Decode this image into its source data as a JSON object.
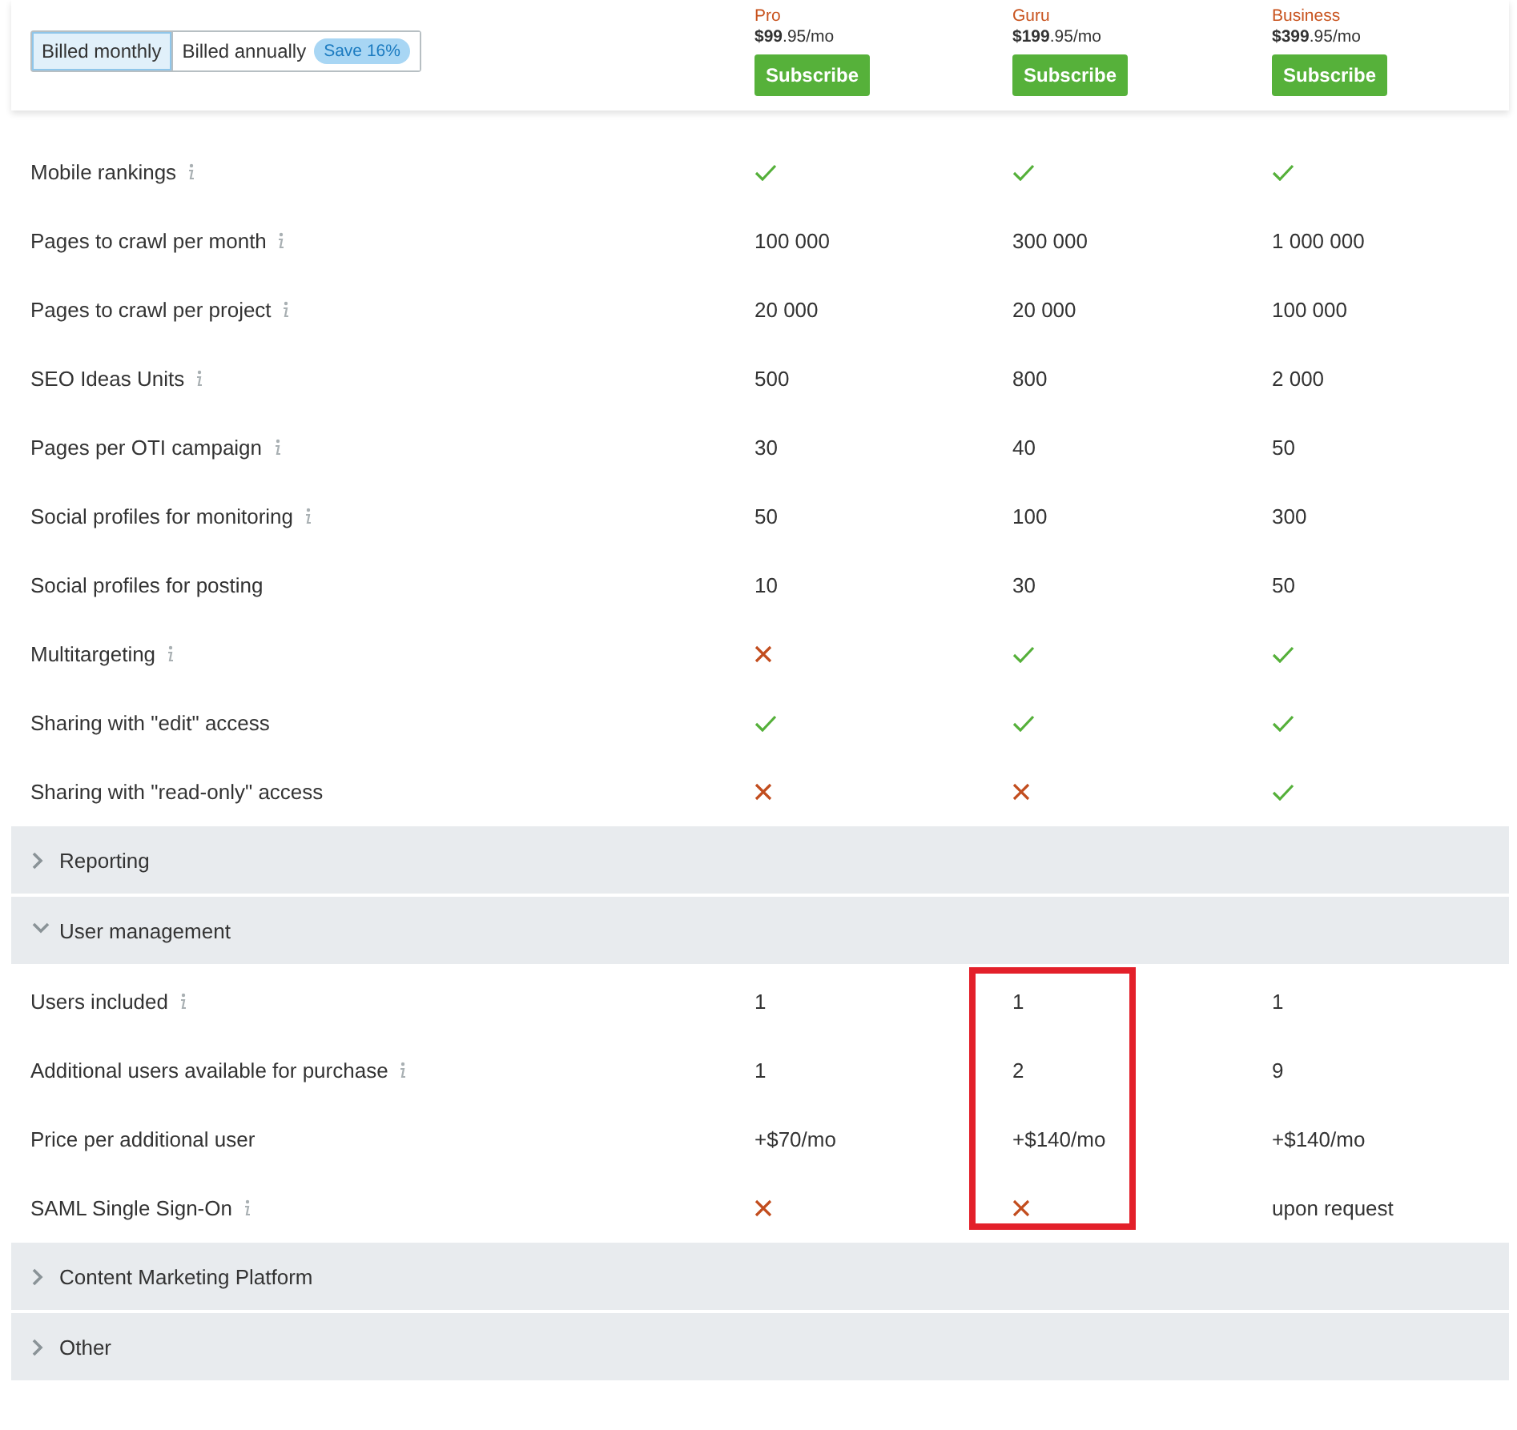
{
  "billing_toggle": {
    "options": [
      {
        "label": "Billed monthly",
        "selected": true
      },
      {
        "label": "Billed annually",
        "selected": false,
        "badge": "Save 16%"
      }
    ]
  },
  "plans": [
    {
      "name": "Pro",
      "price": "**$99**.95/mo",
      "button": "Subscribe"
    },
    {
      "name": "Guru",
      "price": "**$199**.95/mo",
      "button": "Subscribe"
    },
    {
      "name": "Business",
      "price": "**$399**.95/mo",
      "button": "Subscribe"
    }
  ],
  "sections": [
    {
      "kind": "rows",
      "rows": [
        {
          "label": "Mobile rankings",
          "info": true,
          "values": [
            {
              "kind": "check",
              "highlighted": false
            },
            {
              "kind": "check",
              "highlighted": false
            },
            {
              "kind": "check",
              "highlighted": false
            }
          ]
        },
        {
          "label": "Pages to crawl per month",
          "info": true,
          "values": [
            {
              "kind": "text",
              "text": "100 000",
              "highlighted": false
            },
            {
              "kind": "text",
              "text": "300 000",
              "highlighted": false
            },
            {
              "kind": "text",
              "text": "1 000 000",
              "highlighted": false
            }
          ]
        },
        {
          "label": "Pages to crawl per project",
          "info": true,
          "values": [
            {
              "kind": "text",
              "text": "20 000",
              "highlighted": false
            },
            {
              "kind": "text",
              "text": "20 000",
              "highlighted": false
            },
            {
              "kind": "text",
              "text": "100 000",
              "highlighted": false
            }
          ]
        },
        {
          "label": "SEO Ideas Units",
          "info": true,
          "values": [
            {
              "kind": "text",
              "text": "500",
              "highlighted": false
            },
            {
              "kind": "text",
              "text": "800",
              "highlighted": false
            },
            {
              "kind": "text",
              "text": "2 000",
              "highlighted": false
            }
          ]
        },
        {
          "label": "Pages per OTI campaign",
          "info": true,
          "values": [
            {
              "kind": "text",
              "text": "30",
              "highlighted": false
            },
            {
              "kind": "text",
              "text": "40",
              "highlighted": false
            },
            {
              "kind": "text",
              "text": "50",
              "highlighted": false
            }
          ]
        },
        {
          "label": "Social profiles for monitoring",
          "info": true,
          "values": [
            {
              "kind": "text",
              "text": "50",
              "highlighted": false
            },
            {
              "kind": "text",
              "text": "100",
              "highlighted": false
            },
            {
              "kind": "text",
              "text": "300",
              "highlighted": false
            }
          ]
        },
        {
          "label": "Social profiles for posting",
          "info": false,
          "values": [
            {
              "kind": "text",
              "text": "10",
              "highlighted": false
            },
            {
              "kind": "text",
              "text": "30",
              "highlighted": false
            },
            {
              "kind": "text",
              "text": "50",
              "highlighted": false
            }
          ]
        },
        {
          "label": "Multitargeting",
          "info": true,
          "values": [
            {
              "kind": "cross",
              "highlighted": false
            },
            {
              "kind": "check",
              "highlighted": false
            },
            {
              "kind": "check",
              "highlighted": false
            }
          ]
        },
        {
          "label": "Sharing with \"edit\" access",
          "info": false,
          "values": [
            {
              "kind": "check",
              "highlighted": false
            },
            {
              "kind": "check",
              "highlighted": false
            },
            {
              "kind": "check",
              "highlighted": false
            }
          ]
        },
        {
          "label": "Sharing with \"read-only\" access",
          "info": false,
          "values": [
            {
              "kind": "cross",
              "highlighted": false
            },
            {
              "kind": "cross",
              "highlighted": false
            },
            {
              "kind": "check",
              "highlighted": false
            }
          ]
        }
      ]
    },
    {
      "kind": "group",
      "title": "Reporting",
      "expanded": false
    },
    {
      "kind": "group",
      "title": "User management",
      "expanded": true
    },
    {
      "kind": "rows",
      "rows": [
        {
          "label": "Users included",
          "info": true,
          "values": [
            {
              "kind": "text",
              "text": "1",
              "highlighted": false
            },
            {
              "kind": "text",
              "text": "1",
              "highlighted": true
            },
            {
              "kind": "text",
              "text": "1",
              "highlighted": false
            }
          ]
        },
        {
          "label": "Additional users available for purchase",
          "info": true,
          "values": [
            {
              "kind": "text",
              "text": "1",
              "highlighted": false
            },
            {
              "kind": "text",
              "text": "2",
              "highlighted": true
            },
            {
              "kind": "text",
              "text": "9",
              "highlighted": false
            }
          ]
        },
        {
          "label": "Price per additional user",
          "info": false,
          "values": [
            {
              "kind": "text",
              "text": "+$70/mo",
              "highlighted": false
            },
            {
              "kind": "text",
              "text": "+$140/mo",
              "highlighted": true
            },
            {
              "kind": "text",
              "text": "+$140/mo",
              "highlighted": false
            }
          ]
        },
        {
          "label": "SAML Single Sign-On",
          "info": true,
          "values": [
            {
              "kind": "cross",
              "highlighted": false
            },
            {
              "kind": "cross",
              "highlighted": true
            },
            {
              "kind": "text",
              "text": "upon request",
              "highlighted": false
            }
          ]
        }
      ]
    },
    {
      "kind": "group",
      "title": "Content Marketing Platform",
      "expanded": false
    },
    {
      "kind": "group",
      "title": "Other",
      "expanded": false
    }
  ]
}
